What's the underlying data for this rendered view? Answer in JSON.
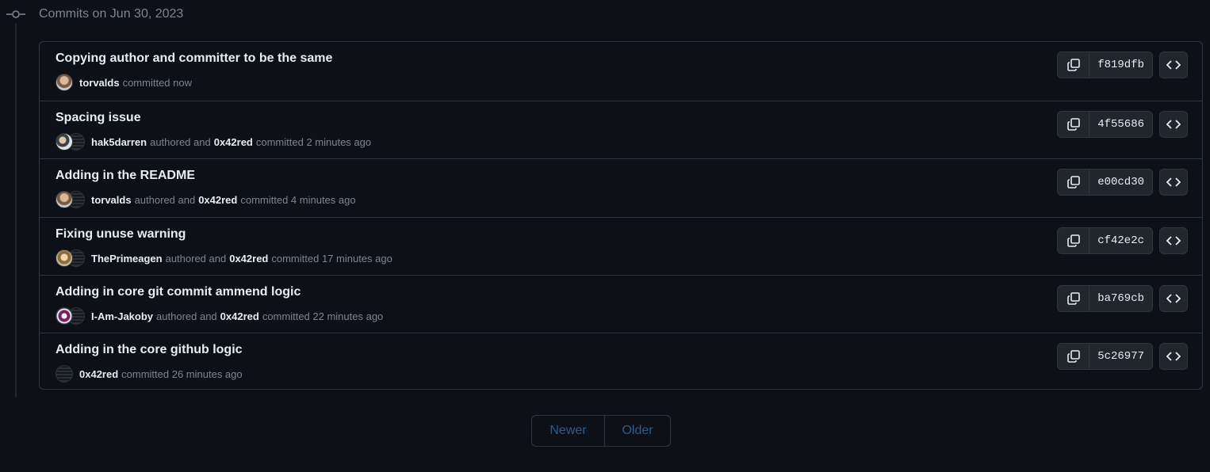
{
  "group": {
    "title": "Commits on Jun 30, 2023"
  },
  "commits": [
    {
      "title": "Copying author and committer to be the same",
      "author": "torvalds",
      "authored_text": "",
      "committer": "",
      "committed_text": "committed now",
      "sha": "f819dfb"
    },
    {
      "title": "Spacing issue",
      "author": "hak5darren",
      "authored_text": "authored and",
      "committer": "0x42red",
      "committed_text": "committed 2 minutes ago",
      "sha": "4f55686"
    },
    {
      "title": "Adding in the README",
      "author": "torvalds",
      "authored_text": "authored and",
      "committer": "0x42red",
      "committed_text": "committed 4 minutes ago",
      "sha": "e00cd30"
    },
    {
      "title": "Fixing unuse warning",
      "author": "ThePrimeagen",
      "authored_text": "authored and",
      "committer": "0x42red",
      "committed_text": "committed 17 minutes ago",
      "sha": "cf42e2c"
    },
    {
      "title": "Adding in core git commit ammend logic",
      "author": "I-Am-Jakoby",
      "authored_text": "authored and",
      "committer": "0x42red",
      "committed_text": "committed 22 minutes ago",
      "sha": "ba769cb"
    },
    {
      "title": "Adding in the core github logic",
      "author": "0x42red",
      "authored_text": "",
      "committer": "",
      "committed_text": "committed 26 minutes ago",
      "sha": "5c26977"
    }
  ],
  "pagination": {
    "newer_label": "Newer",
    "older_label": "Older"
  },
  "icons": {
    "commit_node": "git-commit-icon",
    "copy": "copy-icon",
    "browse": "code-brackets-icon"
  },
  "colors": {
    "background": "#0d1117",
    "border": "#30363d",
    "muted_text": "#7d8590",
    "disabled_link": "#2f5a8a"
  }
}
